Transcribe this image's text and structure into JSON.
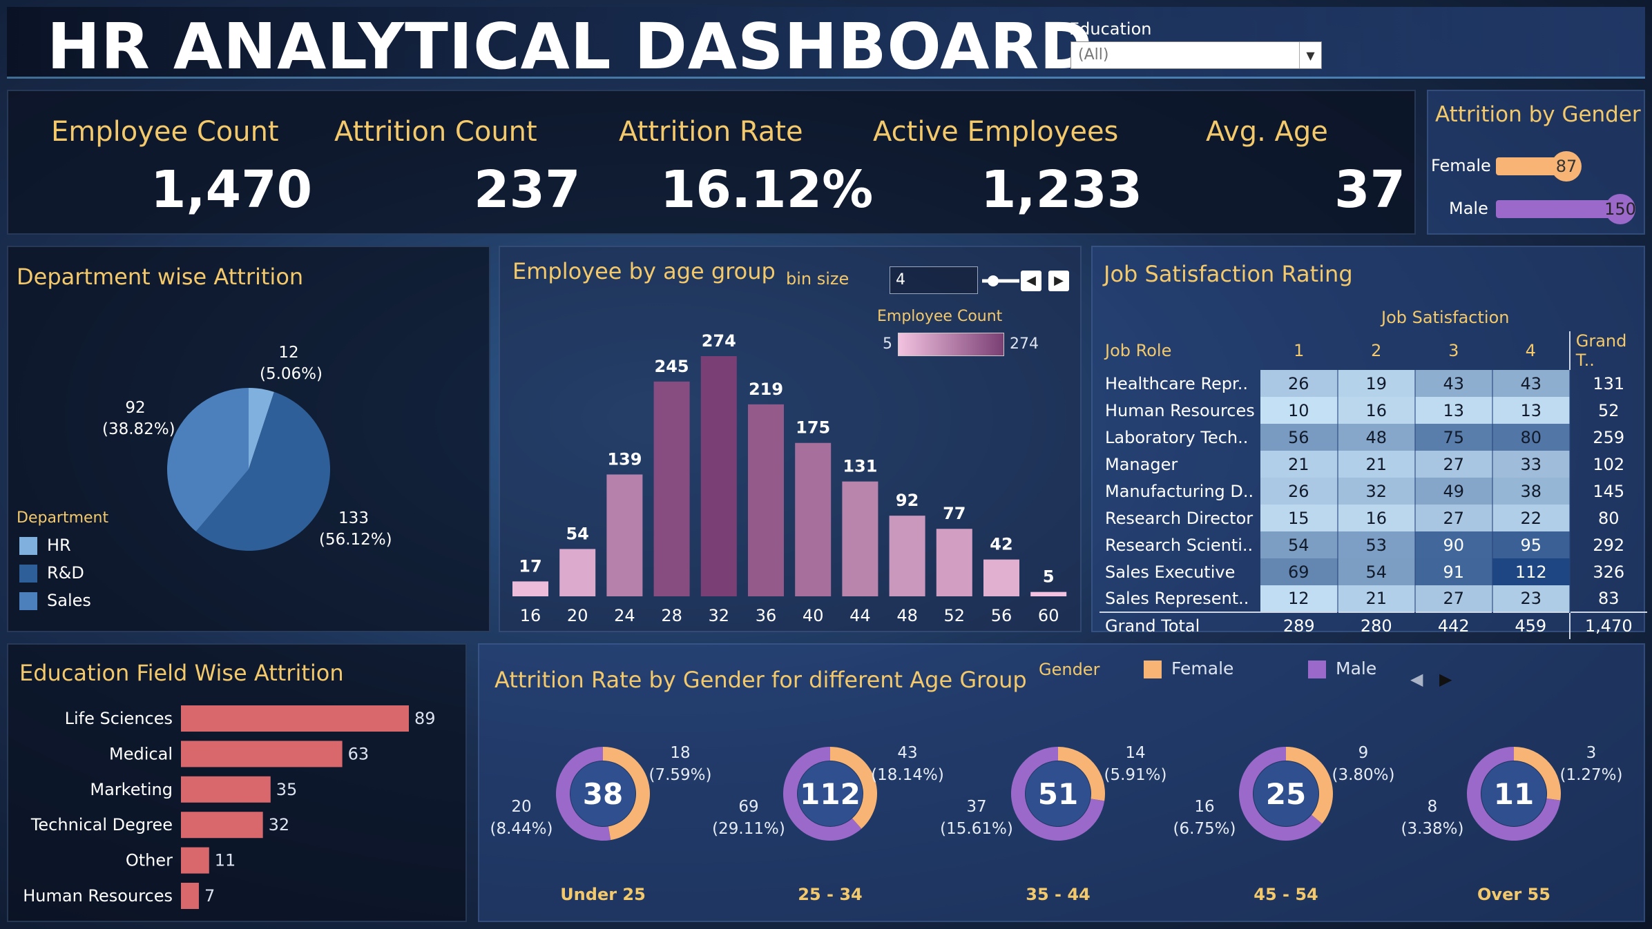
{
  "header": {
    "title": "HR ANALYTICAL DASHBOARD"
  },
  "filter": {
    "label": "Education",
    "value": "(All)"
  },
  "kpis": [
    {
      "label": "Employee Count",
      "value": "1,470"
    },
    {
      "label": "Attrition Count",
      "value": "237"
    },
    {
      "label": "Attrition Rate",
      "value": "16.12%"
    },
    {
      "label": "Active Employees",
      "value": "1,233"
    },
    {
      "label": "Avg. Age",
      "value": "37"
    }
  ],
  "gender_panel": {
    "title": "Attrition by Gender",
    "rows": [
      {
        "label": "Female",
        "value": "87",
        "color": "#f7b474"
      },
      {
        "label": "Male",
        "value": "150",
        "color": "#9b69c9"
      }
    ]
  },
  "dept_panel": {
    "title": "Department wise Attrition",
    "legend_title": "Department",
    "legend": [
      {
        "label": "HR",
        "color": "#7fb0de"
      },
      {
        "label": "R&D",
        "color": "#2f5f98"
      },
      {
        "label": "Sales",
        "color": "#4b80bd"
      }
    ],
    "labels": [
      {
        "count": "12",
        "pct": "(5.06%)"
      },
      {
        "count": "133",
        "pct": "(56.12%)"
      },
      {
        "count": "92",
        "pct": "(38.82%)"
      }
    ]
  },
  "age_panel": {
    "title": "Employee by age group",
    "bin_label": "bin size",
    "bin_value": "4",
    "legend_title": "Employee Count",
    "legend_min": "5",
    "legend_max": "274"
  },
  "job_panel": {
    "title": "Job Satisfaction Rating",
    "col_group": "Job Satisfaction",
    "row_header": "Job Role",
    "columns": [
      "1",
      "2",
      "3",
      "4"
    ],
    "grand_header": "Grand T..",
    "rows": [
      {
        "role": "Healthcare Repr..",
        "v": [
          "26",
          "19",
          "43",
          "43"
        ],
        "total": "131"
      },
      {
        "role": "Human Resources",
        "v": [
          "10",
          "16",
          "13",
          "13"
        ],
        "total": "52"
      },
      {
        "role": "Laboratory Tech..",
        "v": [
          "56",
          "48",
          "75",
          "80"
        ],
        "total": "259"
      },
      {
        "role": "Manager",
        "v": [
          "21",
          "21",
          "27",
          "33"
        ],
        "total": "102"
      },
      {
        "role": "Manufacturing D..",
        "v": [
          "26",
          "32",
          "49",
          "38"
        ],
        "total": "145"
      },
      {
        "role": "Research Director",
        "v": [
          "15",
          "16",
          "27",
          "22"
        ],
        "total": "80"
      },
      {
        "role": "Research Scienti..",
        "v": [
          "54",
          "53",
          "90",
          "95"
        ],
        "total": "292"
      },
      {
        "role": "Sales Executive",
        "v": [
          "69",
          "54",
          "91",
          "112"
        ],
        "total": "326"
      },
      {
        "role": "Sales Represent..",
        "v": [
          "12",
          "21",
          "27",
          "23"
        ],
        "total": "83"
      }
    ],
    "grand_row": {
      "role": "Grand Total",
      "v": [
        "289",
        "280",
        "442",
        "459"
      ],
      "total": "1,470"
    }
  },
  "edu_panel": {
    "title": "Education Field Wise Attrition"
  },
  "donut_panel": {
    "title": "Attrition Rate by Gender for different Age Group",
    "legend_title": "Gender",
    "legend": [
      {
        "label": "Female",
        "color": "#f7b474"
      },
      {
        "label": "Male",
        "color": "#9b69c9"
      }
    ]
  },
  "chart_data": [
    {
      "type": "pie",
      "title": "Department wise Attrition",
      "categories": [
        "HR",
        "R&D",
        "Sales"
      ],
      "values": [
        12,
        133,
        92
      ],
      "percent": [
        5.06,
        56.12,
        38.82
      ]
    },
    {
      "type": "bar",
      "title": "Employee by age group",
      "categories": [
        "16",
        "20",
        "24",
        "28",
        "32",
        "36",
        "40",
        "44",
        "48",
        "52",
        "56",
        "60"
      ],
      "values": [
        17,
        54,
        139,
        245,
        274,
        219,
        175,
        131,
        92,
        77,
        42,
        5
      ],
      "color_range": [
        5,
        274
      ]
    },
    {
      "type": "heatmap",
      "title": "Job Satisfaction Rating",
      "x": [
        "1",
        "2",
        "3",
        "4"
      ],
      "y": [
        "Healthcare Repr..",
        "Human Resources",
        "Laboratory Tech..",
        "Manager",
        "Manufacturing D..",
        "Research Director",
        "Research Scienti..",
        "Sales Executive",
        "Sales Represent.."
      ],
      "values": [
        [
          26,
          19,
          43,
          43
        ],
        [
          10,
          16,
          13,
          13
        ],
        [
          56,
          48,
          75,
          80
        ],
        [
          21,
          21,
          27,
          33
        ],
        [
          26,
          32,
          49,
          38
        ],
        [
          15,
          16,
          27,
          22
        ],
        [
          54,
          53,
          90,
          95
        ],
        [
          69,
          54,
          91,
          112
        ],
        [
          12,
          21,
          27,
          23
        ]
      ]
    },
    {
      "type": "bar",
      "title": "Education Field Wise Attrition",
      "orientation": "horizontal",
      "categories": [
        "Life Sciences",
        "Medical",
        "Marketing",
        "Technical Degree",
        "Other",
        "Human Resources"
      ],
      "values": [
        89,
        63,
        35,
        32,
        11,
        7
      ]
    },
    {
      "type": "pie",
      "title": "Attrition Rate by Gender for different Age Group",
      "groups": [
        {
          "category": "Under 25",
          "total": 38,
          "female": 18,
          "female_pct": "(7.59%)",
          "male": 20,
          "male_pct": "(8.44%)"
        },
        {
          "category": "25 - 34",
          "total": 112,
          "female": 43,
          "female_pct": "(18.14%)",
          "male": 69,
          "male_pct": "(29.11%)"
        },
        {
          "category": "35 - 44",
          "total": 51,
          "female": 14,
          "female_pct": "(5.91%)",
          "male": 37,
          "male_pct": "(15.61%)"
        },
        {
          "category": "45 - 54",
          "total": 25,
          "female": 9,
          "female_pct": "(3.80%)",
          "male": 16,
          "male_pct": "(6.75%)"
        },
        {
          "category": "Over 55",
          "total": 11,
          "female": 3,
          "female_pct": "(1.27%)",
          "male": 8,
          "male_pct": "(3.38%)"
        }
      ]
    }
  ]
}
